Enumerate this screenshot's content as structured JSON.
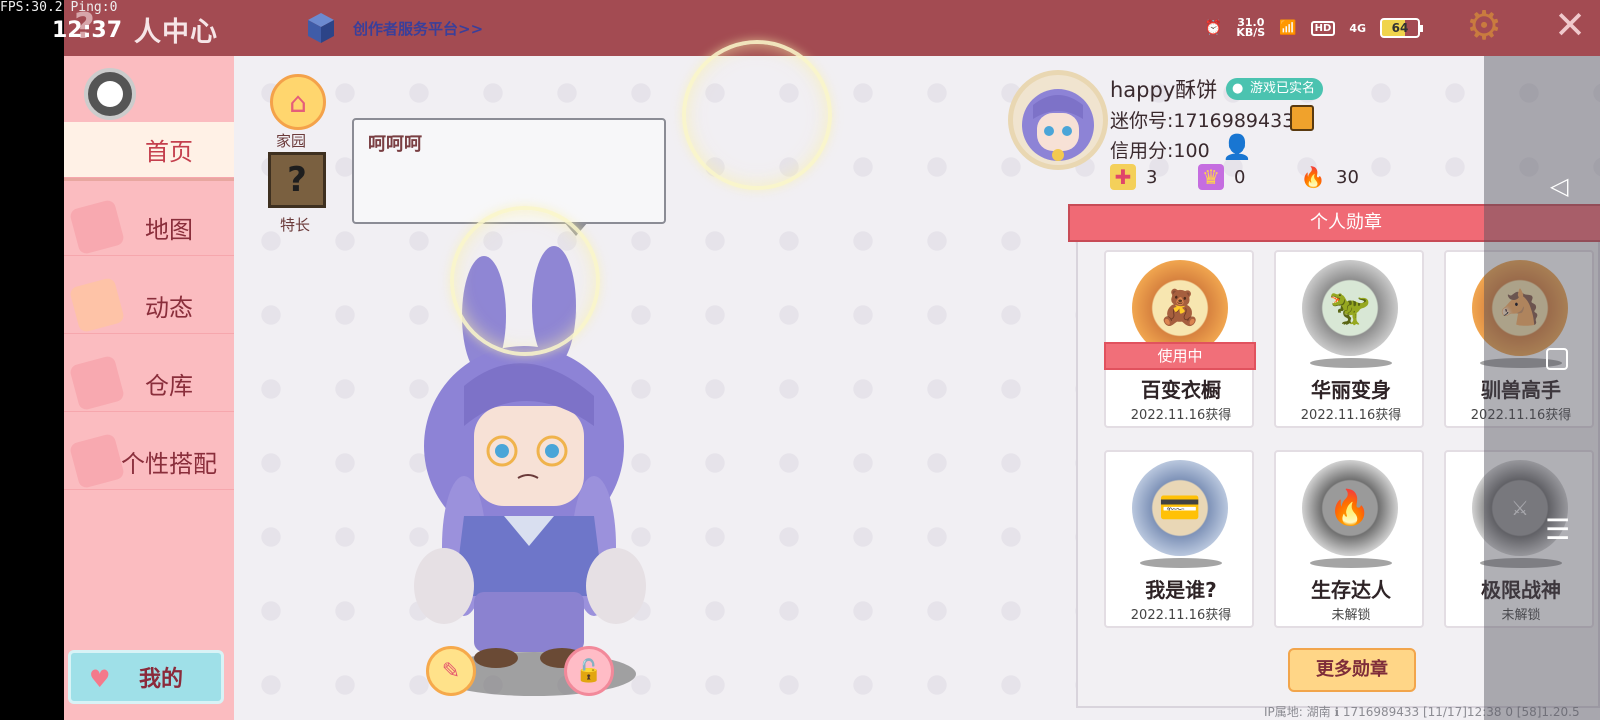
{
  "overlay": {
    "fps": "FPS:30.2  Ping:0",
    "clock": "12:37"
  },
  "status": {
    "speed": "31.0",
    "speed_unit": "KB/S",
    "hd": "HD",
    "network": "4G",
    "battery": "64"
  },
  "topbar": {
    "help": "?",
    "title": "人中心",
    "creator_link": "创作者服务平台>>"
  },
  "sidebar": {
    "items": [
      {
        "label": "首页",
        "active": true
      },
      {
        "label": "地图",
        "active": false
      },
      {
        "label": "动态",
        "active": false
      },
      {
        "label": "仓库",
        "active": false
      },
      {
        "label": "个性搭配",
        "active": false
      }
    ],
    "my_button": "我的"
  },
  "main": {
    "home_label": "家园",
    "talent_label": "特长",
    "talent_icon": "?",
    "speech": "呵呵呵"
  },
  "profile": {
    "username": "happy酥饼",
    "realname_badge": "游戏已实名",
    "mini_id": "迷你号:1716989433",
    "credit": "信用分:100",
    "stats": {
      "likes": "3",
      "fans": "0",
      "hot": "30"
    }
  },
  "badges": {
    "title": "个人勋章",
    "in_use_label": "使用中",
    "items": [
      {
        "name": "百变衣橱",
        "status": "2022.11.16获得",
        "medal": "gold",
        "icon": "bear"
      },
      {
        "name": "华丽变身",
        "status": "2022.11.16获得",
        "medal": "silver",
        "icon": "dino"
      },
      {
        "name": "驯兽高手",
        "status": "2022.11.16获得",
        "medal": "gold",
        "icon": "horse"
      },
      {
        "name": "我是谁?",
        "status": "2022.11.16获得",
        "medal": "blue",
        "icon": "card"
      },
      {
        "name": "生存达人",
        "status": "未解锁",
        "medal": "locked",
        "icon": "fire"
      },
      {
        "name": "极限战神",
        "status": "未解锁",
        "medal": "locked",
        "icon": "boss"
      }
    ],
    "more_button": "更多勋章"
  },
  "footer": {
    "text": "IP属地: 湖南 ℹ      1716989433   [11/17]12:38 0  [58]1.20.5"
  },
  "colors": {
    "topbar": "#a34b52",
    "sidebar": "#fbbcc0",
    "accent": "#f06a75"
  }
}
